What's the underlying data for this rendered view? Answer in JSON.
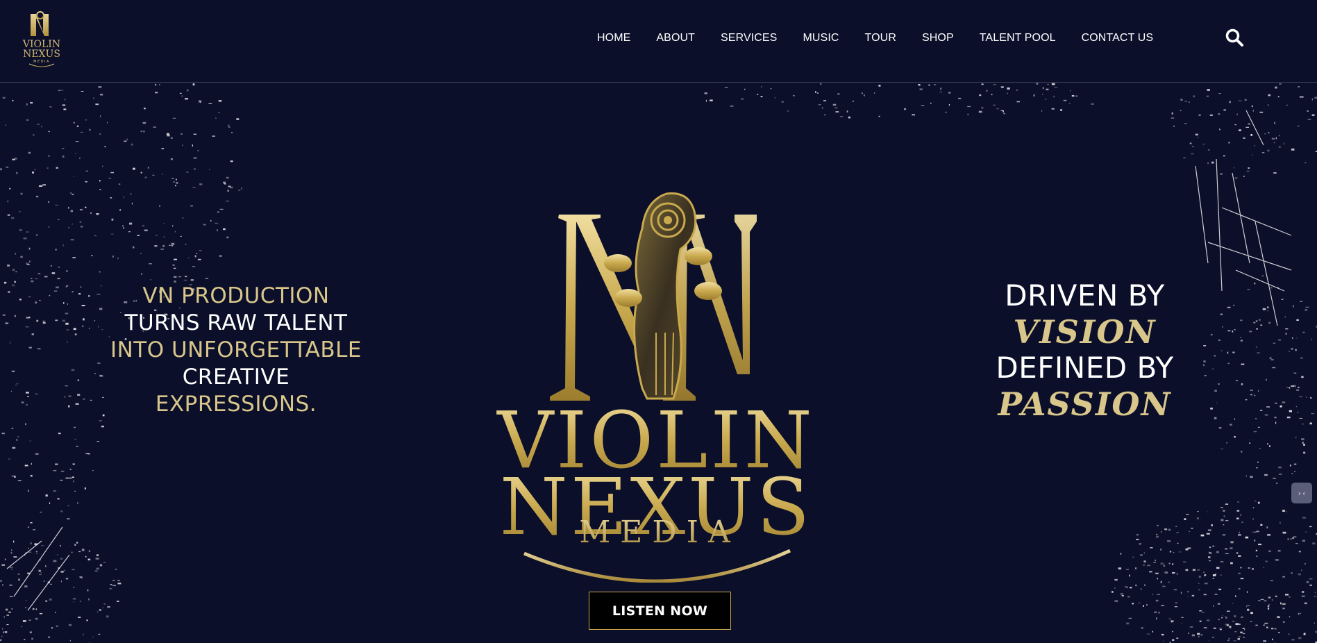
{
  "brand": {
    "small_logo_line1": "VIOLIN",
    "small_logo_line2": "NEXUS",
    "small_logo_line3": "MEDIA",
    "logo_word1": "VIOLIN",
    "logo_word2": "NEXUS",
    "logo_word3": "MEDIA",
    "gold": "#c9a94e",
    "background": "#0b0f2a"
  },
  "nav": {
    "items": [
      {
        "label": "HOME"
      },
      {
        "label": "ABOUT"
      },
      {
        "label": "SERVICES"
      },
      {
        "label": "MUSIC"
      },
      {
        "label": "TOUR"
      },
      {
        "label": "SHOP"
      },
      {
        "label": "TALENT POOL"
      },
      {
        "label": "CONTACT US"
      }
    ],
    "search_icon": "search-icon"
  },
  "hero": {
    "tagline": {
      "line1": "VN PRODUCTION",
      "line2": "TURNS RAW TALENT",
      "line3": "INTO UNFORGETTABLE",
      "line4": "CREATIVE",
      "line5": "EXPRESSIONS."
    },
    "motto": {
      "line1": "DRIVEN BY",
      "line2": "VISION",
      "line3": "DEFINED BY",
      "line4": "PASSION"
    },
    "cta_label": "LISTEN NOW"
  },
  "widget": {
    "icon": "code-icon",
    "glyph": "›‹"
  }
}
